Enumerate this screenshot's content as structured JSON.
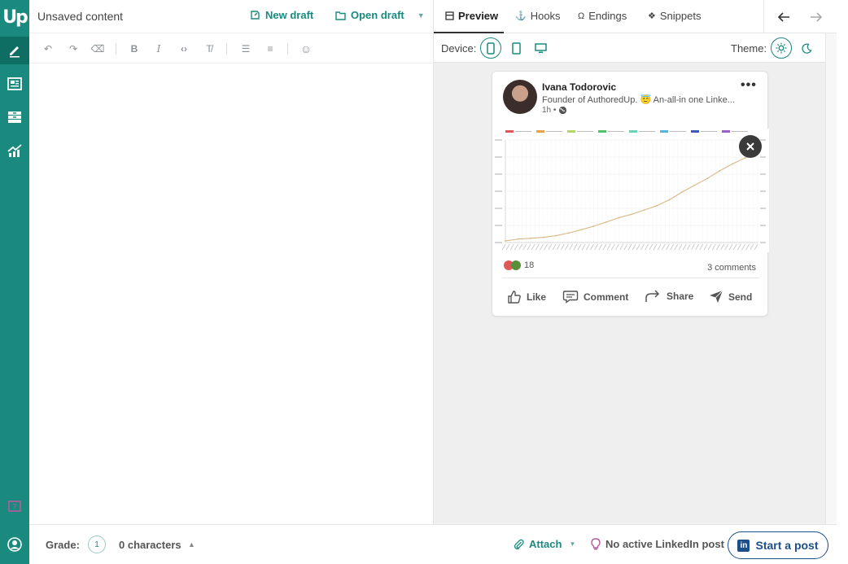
{
  "app": {
    "logo_text": "Up",
    "brand_color": "#1a8a7e",
    "linkedin_color": "#1c4e8a"
  },
  "rail": {
    "items": [
      {
        "icon": "pen-icon",
        "active": true
      },
      {
        "icon": "newspaper-icon",
        "active": false
      },
      {
        "icon": "archive-icon",
        "active": false
      },
      {
        "icon": "analytics-icon",
        "active": false
      },
      {
        "icon": "help-icon",
        "active": false
      },
      {
        "icon": "user-icon",
        "active": false
      }
    ]
  },
  "editor": {
    "title": "Unsaved content",
    "new_draft_label": "New draft",
    "open_draft_label": "Open draft",
    "toolbar": [
      "undo-icon",
      "redo-icon",
      "eraser-icon",
      "bold-icon",
      "italic-icon",
      "code-icon",
      "clear-format-icon",
      "bullet-list-icon",
      "numbered-list-icon",
      "emoji-icon"
    ]
  },
  "preview": {
    "tabs": [
      {
        "label": "Preview",
        "active": true,
        "icon": "preview-icon"
      },
      {
        "label": "Hooks",
        "active": false,
        "icon": "anchor-icon"
      },
      {
        "label": "Endings",
        "active": false,
        "icon": "omega-icon"
      },
      {
        "label": "Snippets",
        "active": false,
        "icon": "puzzle-icon"
      }
    ],
    "device_label": "Device:",
    "theme_label": "Theme:",
    "devices": [
      {
        "icon": "phone-icon",
        "selected": true
      },
      {
        "icon": "tablet-icon",
        "selected": false
      },
      {
        "icon": "desktop-icon",
        "selected": false
      }
    ],
    "themes": [
      {
        "icon": "sun-icon",
        "selected": true
      },
      {
        "icon": "moon-icon",
        "selected": false
      }
    ]
  },
  "post": {
    "author": "Ivana Todorovic",
    "subtitle": "Founder of AuthoredUp. 😇 An-all-in one Linke...",
    "time": "1h •",
    "reaction_count": "18",
    "comments": "3 comments",
    "actions": [
      "Like",
      "Comment",
      "Share",
      "Send"
    ]
  },
  "chart_data": {
    "type": "line",
    "title": "",
    "xlabel": "",
    "ylabel": "",
    "legend_colors": [
      "#e0575a",
      "#e8a24a",
      "#b5d66a",
      "#4fc26a",
      "#69d4b8",
      "#5ab5dc",
      "#3f5bb8",
      "#9a5fc9"
    ],
    "x": [
      0,
      5,
      10,
      15,
      20,
      25,
      30,
      35,
      40,
      45,
      50,
      55,
      60,
      65,
      70,
      75,
      80,
      85,
      90,
      95,
      100
    ],
    "series": [
      {
        "values": [
          2,
          4,
          5,
          6,
          8,
          11,
          15,
          19,
          24,
          29,
          33,
          38,
          43,
          50,
          59,
          67,
          75,
          84,
          92,
          99,
          105
        ],
        "color": "#d8b887"
      }
    ],
    "ylim": [
      0,
      120
    ],
    "grid": true
  },
  "footer": {
    "grade_label": "Grade:",
    "grade_value": "1",
    "characters": "0 characters",
    "attach_label": "Attach",
    "linkedin_status": "No active LinkedIn post",
    "start_post_label": "Start a post",
    "linkedin_badge": "in"
  }
}
